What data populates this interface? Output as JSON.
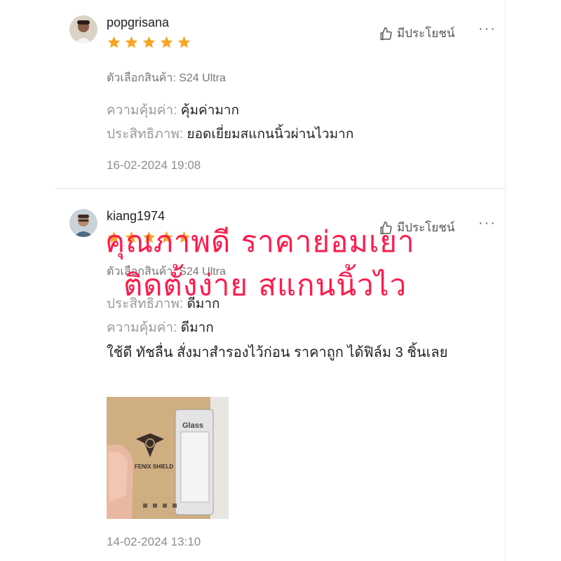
{
  "reviews": [
    {
      "username": "popgrisana",
      "rating": 5,
      "helpful_label": "มีประโยชน์",
      "more_label": "···",
      "variant": "ตัวเลือกสินค้า: S24 Ultra",
      "attributes": [
        {
          "key": "ความคุ้มค่า:",
          "value": "คุ้มค่ามาก"
        },
        {
          "key": "ประสิทธิภาพ:",
          "value": "ยอดเยี่ยมสแกนนิ้วผ่านไวมาก"
        }
      ],
      "date": "16-02-2024 19:08"
    },
    {
      "username": "kiang1974",
      "rating": 5,
      "helpful_label": "มีประโยชน์",
      "more_label": "···",
      "variant": "ตัวเลือกสินค้า: S24 Ultra",
      "attributes": [
        {
          "key": "ประสิทธิภาพ:",
          "value": "ดีมาก"
        },
        {
          "key": "ความคุ้มค่า:",
          "value": "ดีมาก"
        }
      ],
      "comment": "ใช้ดี ทัชลื่น สั่งมาสำรองไว้ก่อน ราคาถูก ได้ฟิล์ม 3 ชิ้นเลย",
      "photo_texts": {
        "brand": "FENIX SHIELD",
        "box_label": "Glass"
      },
      "date": "14-02-2024 13:10"
    }
  ],
  "overlay": {
    "line1": "คุณภาพดี ราคาย่อมเยา",
    "line2": "ติดตั้งง่าย สแกนนิ้วไว",
    "color": "#ff1a4b"
  },
  "colors": {
    "star": "#f6a623",
    "text_muted": "#9a9a9a"
  }
}
